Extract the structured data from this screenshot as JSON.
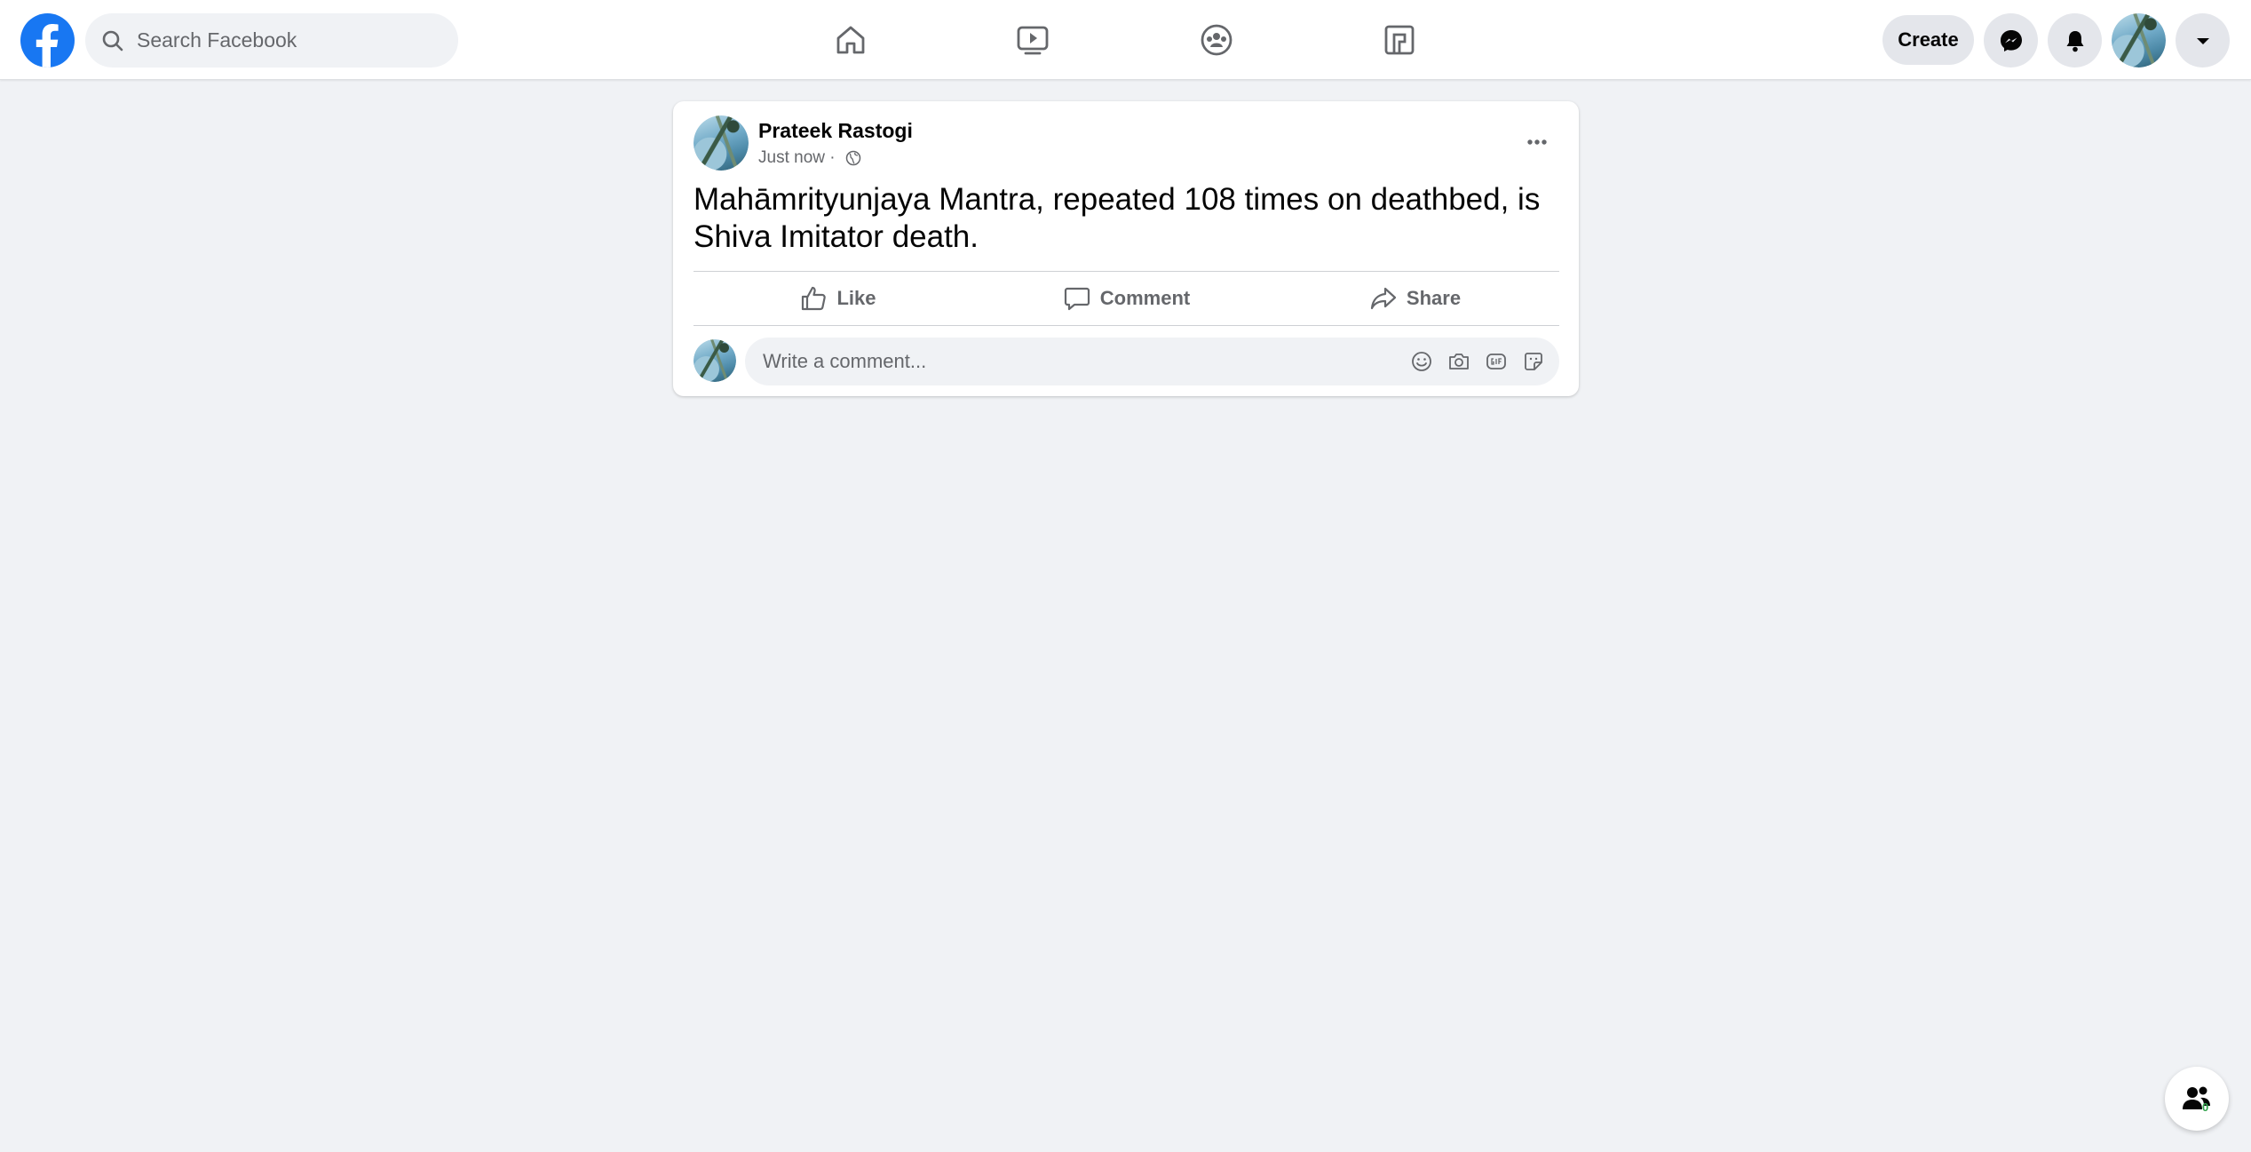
{
  "header": {
    "search_placeholder": "Search Facebook",
    "nav_tabs": [
      {
        "id": "home",
        "icon": "home-icon"
      },
      {
        "id": "watch",
        "icon": "video-icon"
      },
      {
        "id": "groups",
        "icon": "groups-icon"
      },
      {
        "id": "gaming",
        "icon": "gaming-icon"
      }
    ],
    "create_label": "Create",
    "right_icons": [
      "messenger-icon",
      "notifications-bell-icon",
      "account-dropdown-icon"
    ]
  },
  "post": {
    "author": "Prateek Rastogi",
    "time": "Just now",
    "separator": " · ",
    "privacy_icon": "globe-icon",
    "text": "Mahāmrityunjaya Mantra, repeated 108 times on deathbed, is Shiva Imitator death.",
    "actions": {
      "like": "Like",
      "comment": "Comment",
      "share": "Share"
    },
    "comment_placeholder": "Write a comment...",
    "comment_tools": [
      "emoji-icon",
      "camera-icon",
      "gif-icon",
      "sticker-icon"
    ]
  },
  "contacts_button": {
    "badge": "0"
  },
  "colors": {
    "brand_blue": "#1877f2",
    "page_background": "#f0f2f5",
    "secondary_text": "#65676b",
    "online_green": "#31a24c"
  }
}
